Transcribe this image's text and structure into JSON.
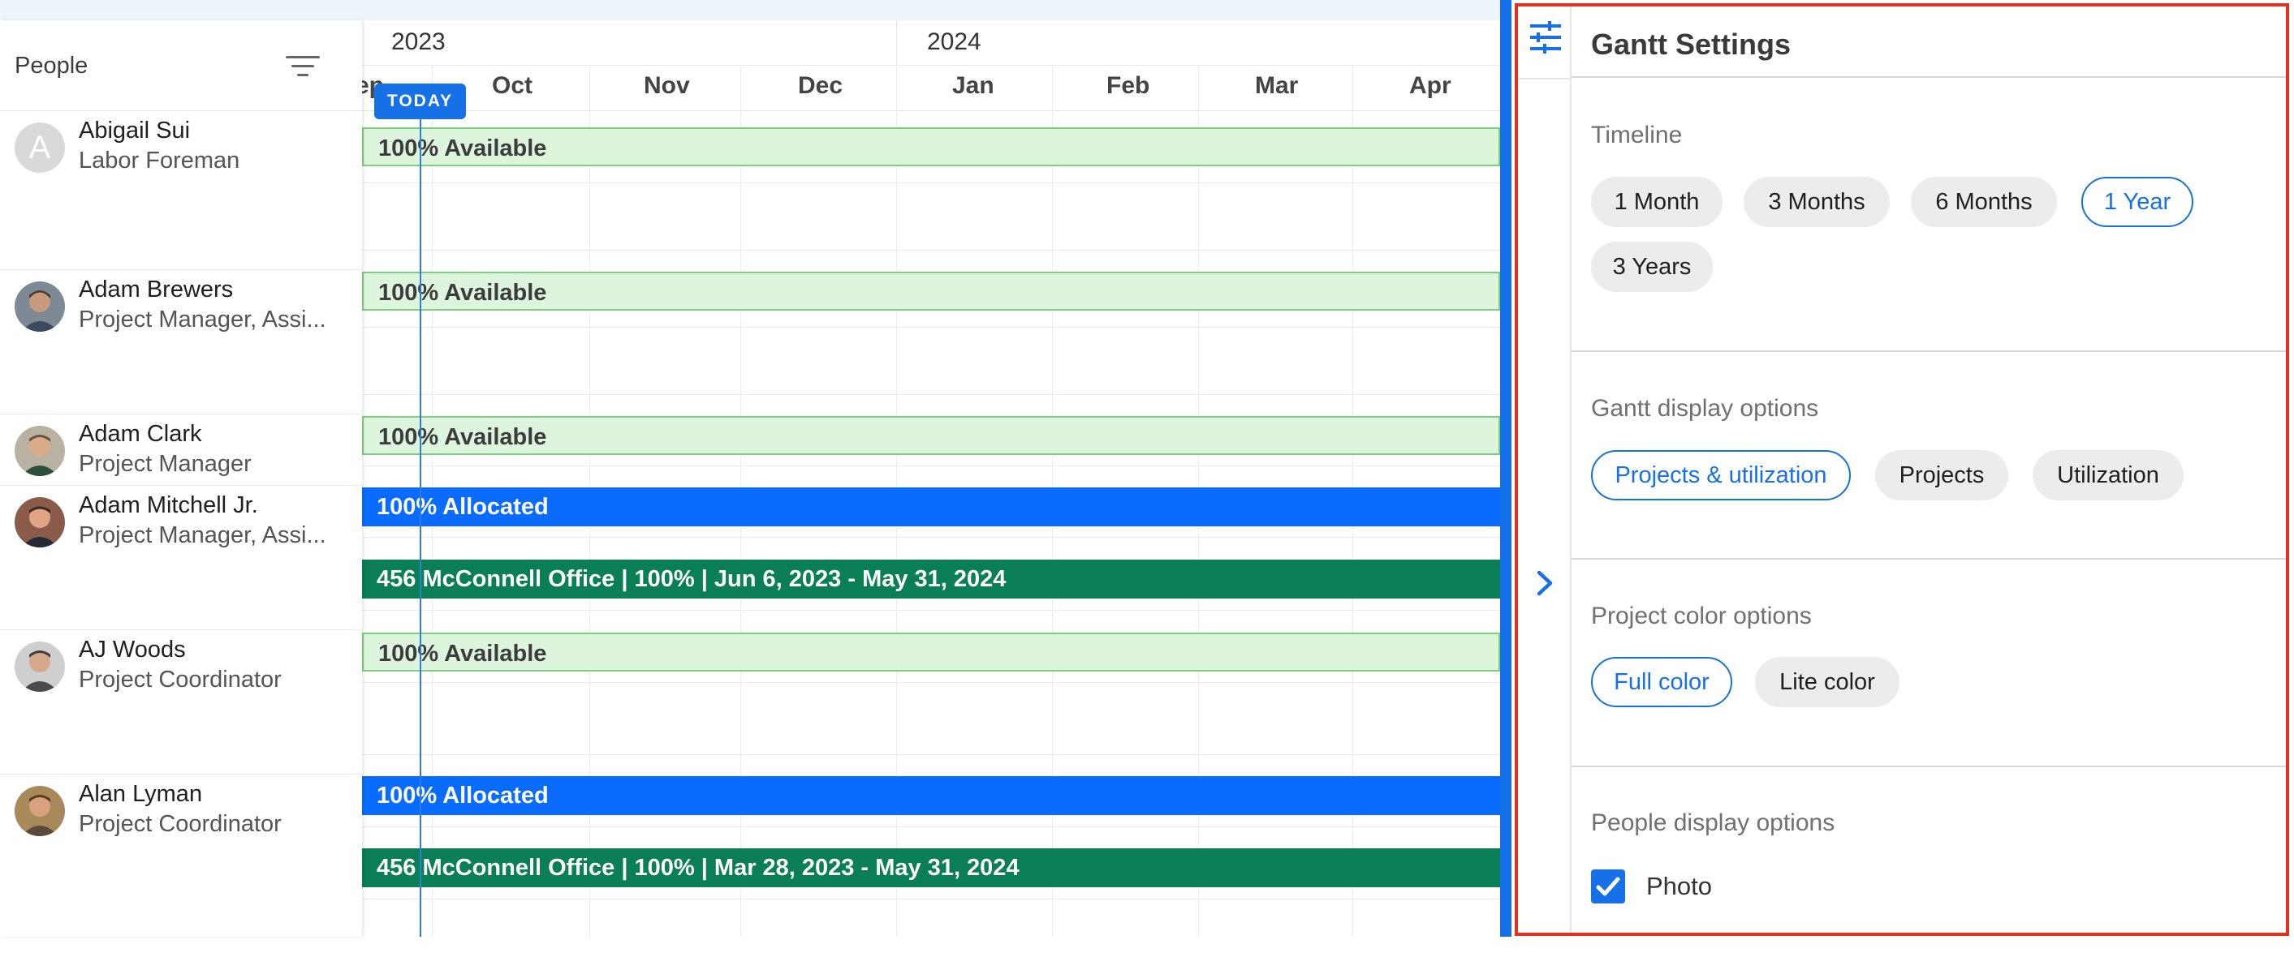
{
  "people_panel": {
    "title": "People",
    "filter_icon": "filter-list-icon"
  },
  "timeline": {
    "years": [
      "2023",
      "2024"
    ],
    "months": [
      "ep",
      "Oct",
      "Nov",
      "Dec",
      "Jan",
      "Feb",
      "Mar",
      "Apr"
    ],
    "today_label": "TODAY"
  },
  "people": [
    {
      "name": "Abigail Sui",
      "role": "Labor Foreman",
      "avatar_letter": "A"
    },
    {
      "name": "Adam Brewers",
      "role": "Project Manager, Assi..."
    },
    {
      "name": "Adam Clark",
      "role": "Project Manager"
    },
    {
      "name": "Adam Mitchell Jr.",
      "role": "Project Manager, Assi..."
    },
    {
      "name": "AJ Woods",
      "role": "Project Coordinator"
    },
    {
      "name": "Alan Lyman",
      "role": "Project Coordinator"
    }
  ],
  "bars": [
    {
      "type": "availability",
      "text": "100% Available"
    },
    {
      "type": "availability",
      "text": "100% Available"
    },
    {
      "type": "availability",
      "text": "100% Available"
    },
    {
      "type": "allocation",
      "text": "100% Allocated"
    },
    {
      "type": "project",
      "text": "456 McConnell Office | 100% | Jun 6, 2023 - May 31, 2024"
    },
    {
      "type": "availability",
      "text": "100% Available"
    },
    {
      "type": "allocation",
      "text": "100% Allocated"
    },
    {
      "type": "project",
      "text": "456 McConnell Office | 100% | Mar 28, 2023 - May 31, 2024"
    }
  ],
  "settings": {
    "title": "Gantt Settings",
    "icon": "tune-icon",
    "collapse_icon": "chevron-right-icon",
    "timeline": {
      "label": "Timeline",
      "options": [
        "1 Month",
        "3 Months",
        "6 Months",
        "1 Year",
        "3 Years"
      ],
      "selected": "1 Year"
    },
    "display": {
      "label": "Gantt display options",
      "options": [
        "Projects & utilization",
        "Projects",
        "Utilization"
      ],
      "selected": "Projects & utilization"
    },
    "color": {
      "label": "Project color options",
      "options": [
        "Full color",
        "Lite color"
      ],
      "selected": "Full color"
    },
    "people_display": {
      "label": "People display options",
      "photo_label": "Photo",
      "photo_checked": true
    }
  },
  "colors": {
    "accent": "#1670e8",
    "allocated": "#0a6cff",
    "project_bar": "#0a7f55",
    "available_fill": "#dcf5dc",
    "available_border": "#7bd27b",
    "highlight_border": "#e2321f"
  }
}
